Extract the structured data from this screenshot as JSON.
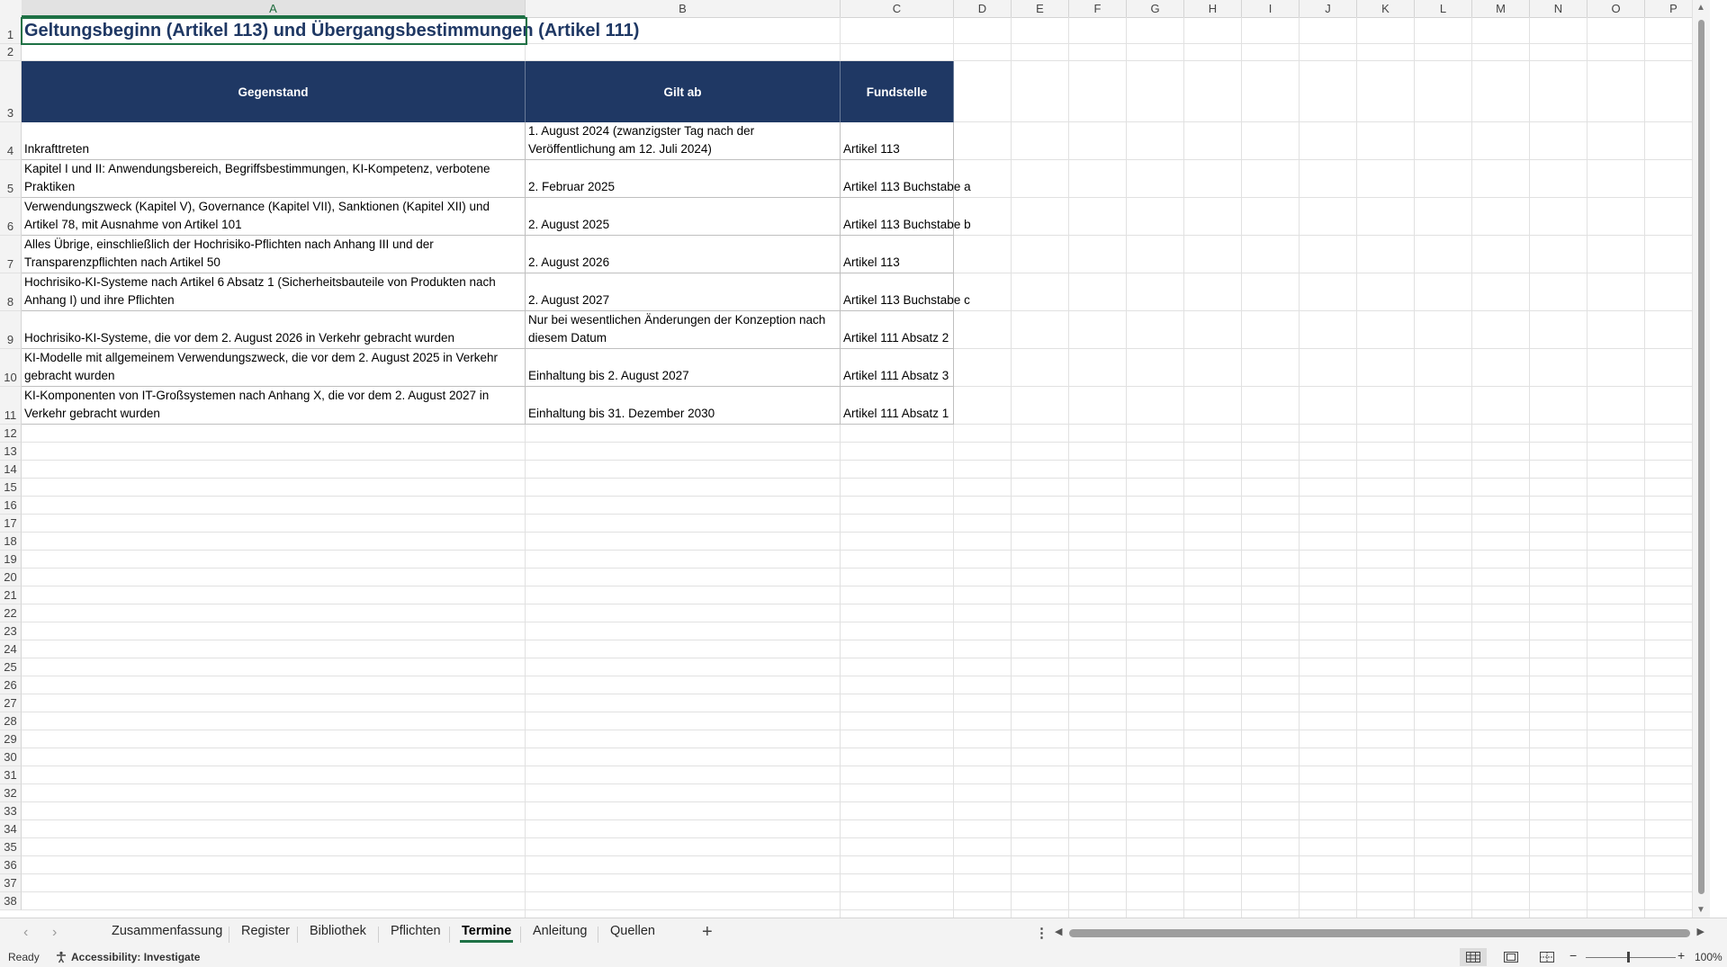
{
  "columns": [
    "A",
    "B",
    "C",
    "D",
    "E",
    "F",
    "G",
    "H",
    "I",
    "J",
    "K",
    "L",
    "M",
    "N",
    "O",
    "P"
  ],
  "active_column": "A",
  "rows": [
    "1",
    "2",
    "3",
    "4",
    "5",
    "6",
    "7",
    "8",
    "9",
    "10",
    "11",
    "12",
    "13",
    "14",
    "15",
    "16",
    "17",
    "18",
    "19",
    "20",
    "21",
    "22",
    "23",
    "24",
    "25",
    "26",
    "27",
    "28",
    "29",
    "30",
    "31",
    "32",
    "33",
    "34",
    "35",
    "36",
    "37",
    "38"
  ],
  "sheet": {
    "title": "Geltungsbeginn (Artikel 113) und Übergangsbestimmungen (Artikel 111)",
    "headers": [
      "Gegenstand",
      "Gilt ab",
      "Fundstelle"
    ],
    "table": [
      [
        "Inkrafttreten",
        "1. August 2024 (zwanzigster Tag nach der Veröffentlichung am 12. Juli 2024)",
        "Artikel 113"
      ],
      [
        "Kapitel I und II: Anwendungsbereich, Begriffsbestimmungen, KI-Kompetenz, verbotene Praktiken",
        "2. Februar 2025",
        "Artikel 113 Buchstabe a"
      ],
      [
        "Verwendungszweck (Kapitel V), Governance (Kapitel VII), Sanktionen (Kapitel XII) und Artikel 78, mit Ausnahme von Artikel 101",
        "2. August 2025",
        "Artikel 113 Buchstabe b"
      ],
      [
        "Alles Übrige, einschließlich der Hochrisiko-Pflichten nach Anhang III und der Transparenzpflichten nach Artikel 50",
        "2. August 2026",
        "Artikel 113"
      ],
      [
        "Hochrisiko-KI-Systeme nach Artikel 6 Absatz 1 (Sicherheitsbauteile von Produkten nach Anhang I) und ihre Pflichten",
        "2. August 2027",
        "Artikel 113 Buchstabe c"
      ],
      [
        "Hochrisiko-KI-Systeme, die vor dem 2. August 2026 in Verkehr gebracht wurden",
        "Nur bei wesentlichen Änderungen der Konzeption nach diesem Datum",
        "Artikel 111 Absatz 2"
      ],
      [
        "KI-Modelle mit allgemeinem Verwendungszweck, die vor dem 2. August 2025 in Verkehr gebracht wurden",
        "Einhaltung bis 2. August 2027",
        "Artikel 111 Absatz 3"
      ],
      [
        "KI-Komponenten von IT-Großsystemen nach Anhang X, die vor dem 2. August 2027 in Verkehr gebracht wurden",
        "Einhaltung bis 31. Dezember 2030",
        "Artikel 111 Absatz 1"
      ]
    ]
  },
  "tabs": [
    "Zusammenfassung",
    "Register",
    "Bibliothek",
    "Pflichten",
    "Termine",
    "Anleitung",
    "Quellen"
  ],
  "active_tab": "Termine",
  "status": {
    "ready": "Ready",
    "accessibility": "Accessibility: Investigate",
    "zoom": "100%"
  },
  "colors": {
    "header_fill": "#1f3864",
    "title_text": "#1f3864",
    "selection": "#1e7145"
  }
}
